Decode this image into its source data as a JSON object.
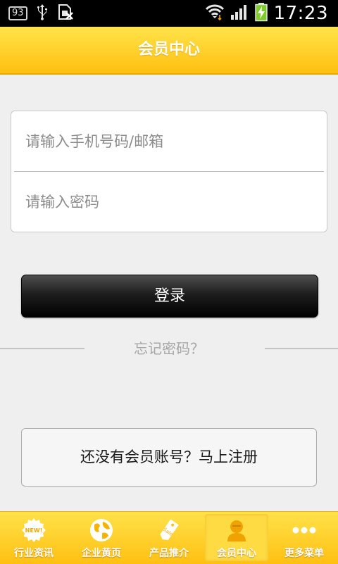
{
  "status_bar": {
    "notification_count": "93",
    "time": "17:23",
    "icons": [
      "usb-icon",
      "sim-card-icon",
      "wifi-icon",
      "signal-icon",
      "battery-charging-icon"
    ]
  },
  "header": {
    "title": "会员中心"
  },
  "login_form": {
    "phone_placeholder": "请输入手机号码/邮箱",
    "password_placeholder": "请输入密码",
    "phone_value": "",
    "password_value": "",
    "login_label": "登录",
    "forgot_label": "忘记密码？",
    "register_label": "还没有会员账号？马上注册"
  },
  "bottom_nav": {
    "items": [
      {
        "label": "行业资讯",
        "icon": "new-badge-icon"
      },
      {
        "label": "企业黄页",
        "icon": "globe-icon"
      },
      {
        "label": "产品推介",
        "icon": "sale-tag-icon"
      },
      {
        "label": "会员中心",
        "icon": "user-icon",
        "active": true
      },
      {
        "label": "更多菜单",
        "icon": "more-dots-icon"
      }
    ]
  },
  "colors": {
    "accent": "#ffc012",
    "header_gradient_top": "#ffe44a",
    "button_dark": "#000000"
  }
}
